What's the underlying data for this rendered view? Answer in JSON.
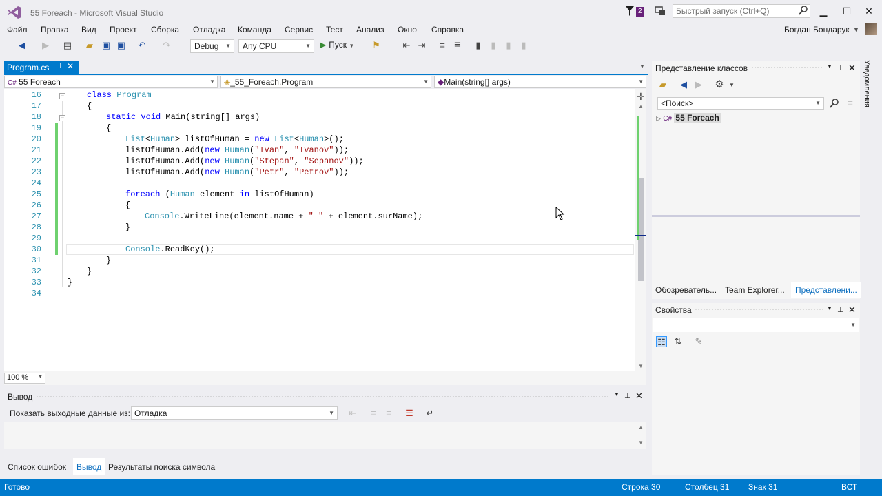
{
  "window": {
    "title": "55 Foreach - Microsoft Visual Studio",
    "notification_count": "2",
    "quick_launch_placeholder": "Быстрый запуск (Ctrl+Q)",
    "user_name": "Богдан Бондарук"
  },
  "menu": [
    "Файл",
    "Правка",
    "Вид",
    "Проект",
    "Сборка",
    "Отладка",
    "Команда",
    "Сервис",
    "Тест",
    "Анализ",
    "Окно",
    "Справка"
  ],
  "toolbar": {
    "config": "Debug",
    "platform": "Any CPU",
    "start_label": "Пуск"
  },
  "editor": {
    "tab_label": "Program.cs",
    "nav_project": "55 Foreach",
    "nav_class": "_55_Foreach.Program",
    "nav_member": "Main(string[] args)",
    "zoom": "100 %",
    "line_numbers": [
      "16",
      "17",
      "18",
      "19",
      "20",
      "21",
      "22",
      "23",
      "24",
      "25",
      "26",
      "27",
      "28",
      "29",
      "30",
      "31",
      "32",
      "33",
      "34"
    ],
    "code": {
      "l16_kw": "class",
      "l16_ty": "Program",
      "l17": "{",
      "l18_kw1": "static",
      "l18_kw2": "void",
      "l18_rest": " Main(string[] args)",
      "l19": "{",
      "l20_ty1": "List",
      "l20_a": "<",
      "l20_ty2": "Human",
      "l20_b": "> listOfHuman = ",
      "l20_kw": "new",
      "l20_sp": " ",
      "l20_ty3": "List",
      "l20_c": "<",
      "l20_ty4": "Human",
      "l20_d": ">();",
      "l21_a": "listOfHuman.Add(",
      "l21_kw": "new",
      "l21_sp": " ",
      "l21_ty": "Human",
      "l21_b": "(",
      "l21_s1": "\"Ivan\"",
      "l21_c": ", ",
      "l21_s2": "\"Ivanov\"",
      "l21_d": "));",
      "l22_a": "listOfHuman.Add(",
      "l22_kw": "new",
      "l22_sp": " ",
      "l22_ty": "Human",
      "l22_b": "(",
      "l22_s1": "\"Stepan\"",
      "l22_c": ", ",
      "l22_s2": "\"Sepanov\"",
      "l22_d": "));",
      "l23_a": "listOfHuman.Add(",
      "l23_kw": "new",
      "l23_sp": " ",
      "l23_ty": "Human",
      "l23_b": "(",
      "l23_s1": "\"Petr\"",
      "l23_c": ", ",
      "l23_s2": "\"Petrov\"",
      "l23_d": "));",
      "l25_kw1": "foreach",
      "l25_a": " (",
      "l25_ty": "Human",
      "l25_b": " element ",
      "l25_kw2": "in",
      "l25_c": " listOfHuman)",
      "l26": "{",
      "l27_ty": "Console",
      "l27_a": ".WriteLine(element.name + ",
      "l27_s": "\" \"",
      "l27_b": " + element.surName);",
      "l28": "}",
      "l30_ty": "Console",
      "l30_a": ".ReadKey();",
      "l31": "}",
      "l32": "}",
      "l33": "}"
    }
  },
  "output": {
    "title": "Вывод",
    "source_label": "Показать выходные данные из:",
    "source_value": "Отладка"
  },
  "bottom_tabs": [
    "Список ошибок",
    "Вывод",
    "Результаты поиска символа"
  ],
  "class_view": {
    "title": "Представление классов",
    "search_value": "<Поиск>",
    "tree_root": "55 Foreach"
  },
  "right_tabs": [
    "Обозреватель...",
    "Team Explorer...",
    "Представлени..."
  ],
  "properties": {
    "title": "Свойства"
  },
  "side_tab": "Уведомления",
  "status": {
    "ready": "Готово",
    "line": "Строка 30",
    "column": "Столбец 31",
    "char": "Знак 31",
    "mode": "ВСТ"
  },
  "colors": {
    "accent": "#007acc",
    "keyword": "#0000ff",
    "type": "#2b91af",
    "string": "#a31515",
    "change_bar": "#6fd16f"
  }
}
